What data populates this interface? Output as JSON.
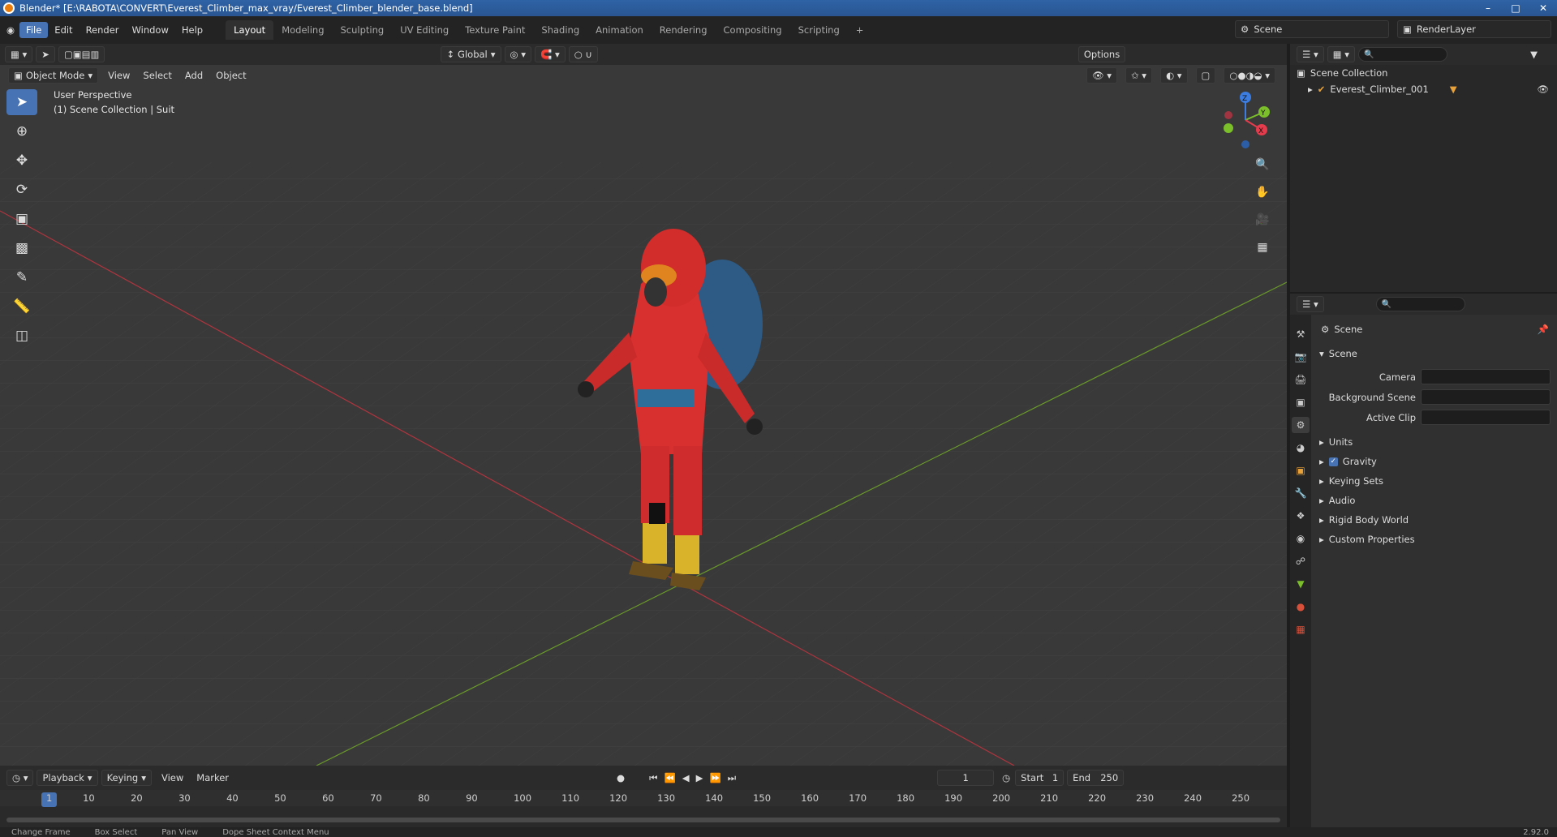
{
  "window": {
    "title": "Blender* [E:\\RABOTA\\CONVERT\\Everest_Climber_max_vray/Everest_Climber_blender_base.blend]",
    "controls": [
      "–",
      "□",
      "✕"
    ]
  },
  "menu": [
    "File",
    "Edit",
    "Render",
    "Window",
    "Help"
  ],
  "workspaces": [
    "Layout",
    "Modeling",
    "Sculpting",
    "UV Editing",
    "Texture Paint",
    "Shading",
    "Animation",
    "Rendering",
    "Compositing",
    "Scripting"
  ],
  "add_workspace": "+",
  "scene_selector": "Scene",
  "renderlayer_selector": "RenderLayer",
  "viewport_header": {
    "transform_orientation": "Global",
    "options": "Options",
    "mode": "Object Mode",
    "menus": [
      "View",
      "Select",
      "Add",
      "Object"
    ]
  },
  "viewport": {
    "perspective": "User Perspective",
    "collection_info": "(1) Scene Collection | Suit",
    "gizmo": {
      "x": "X",
      "y": "Y",
      "z": "Z"
    }
  },
  "outliner": {
    "collection": "Scene Collection",
    "object": "Everest_Climber_001"
  },
  "properties": {
    "context": "Scene",
    "panel": "Scene",
    "fields": [
      {
        "label": "Camera"
      },
      {
        "label": "Background Scene"
      },
      {
        "label": "Active Clip"
      }
    ],
    "sections": [
      "Units",
      "Gravity",
      "Keying Sets",
      "Audio",
      "Rigid Body World",
      "Custom Properties"
    ],
    "gravity_checked": true
  },
  "timeline": {
    "menus": [
      "Playback",
      "Keying",
      "View",
      "Marker"
    ],
    "current_frame": "1",
    "start_label": "Start",
    "start": "1",
    "end_label": "End",
    "end": "250",
    "ruler": [
      "1",
      "10",
      "20",
      "30",
      "40",
      "50",
      "60",
      "70",
      "80",
      "90",
      "100",
      "110",
      "120",
      "130",
      "140",
      "150",
      "160",
      "170",
      "180",
      "190",
      "200",
      "210",
      "220",
      "230",
      "240",
      "250"
    ]
  },
  "status_bar": [
    "Change Frame",
    "Box Select",
    "Pan View",
    "Dope Sheet Context Menu",
    "2.92.0"
  ]
}
